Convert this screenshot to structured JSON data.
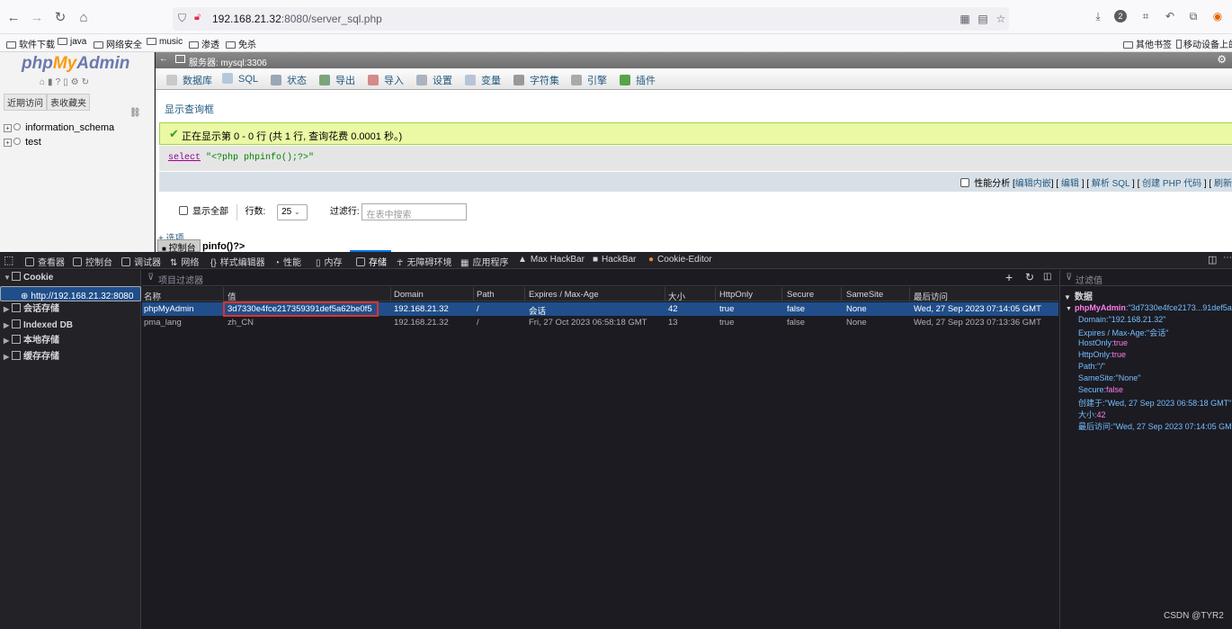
{
  "browser": {
    "url_host": "192.168.21.32",
    "url_rest": ":8080/server_sql.php",
    "bookmarks": [
      "软件下载",
      "java",
      "网络安全",
      "music",
      "渗透",
      "免杀"
    ],
    "bookmarks_right": [
      "其他书签",
      "移动设备上的"
    ]
  },
  "pma": {
    "logo_php": "php",
    "logo_my": "My",
    "logo_admin": "Admin",
    "left_tabs": [
      "近期访问",
      "表收藏夹"
    ],
    "databases": [
      "information_schema",
      "test"
    ],
    "server_label": "服务器: mysql:3306",
    "tabs": [
      "数据库",
      "SQL",
      "状态",
      "导出",
      "导入",
      "设置",
      "变量",
      "字符集",
      "引擎",
      "插件"
    ],
    "show_query_box": "显示查询框",
    "success_msg": "正在显示第 0 - 0 行 (共 1 行, 查询花费 0.0001 秒。)",
    "sql_keyword": "select",
    "sql_string": "\"<?php phpinfo();?>\"",
    "profiling_label": "性能分析",
    "links": [
      "编辑内嵌",
      "编辑",
      "解析 SQL",
      "创建 PHP 代码",
      "刷新"
    ],
    "show_all": "显示全部",
    "rows_label": "行数:",
    "rows_value": "25",
    "filter_label": "过滤行:",
    "filter_placeholder": "在表中搜索",
    "options_link": "+ 选项",
    "console_tab": "控制台",
    "phpinfo_col": "pinfo()?>"
  },
  "devtools": {
    "tabs": [
      "查看器",
      "控制台",
      "调试器",
      "网络",
      "样式编辑器",
      "性能",
      "内存",
      "存储",
      "无障碍环境",
      "应用程序",
      "Max HackBar",
      "HackBar",
      "Cookie-Editor"
    ],
    "active_tab": "存储",
    "tree": {
      "cookie": "Cookie",
      "cookie_host": "http://192.168.21.32:8080",
      "session": "会话存储",
      "indexeddb": "Indexed DB",
      "local": "本地存储",
      "cache": "缓存存储"
    },
    "filter_placeholder": "项目过滤器",
    "columns": [
      "名称",
      "值",
      "Domain",
      "Path",
      "Expires / Max-Age",
      "大小",
      "HttpOnly",
      "Secure",
      "SameSite",
      "最后访问"
    ],
    "rows": [
      [
        "phpMyAdmin",
        "3d7330e4fce217359391def5a62be0f5",
        "192.168.21.32",
        "/",
        "会话",
        "42",
        "true",
        "false",
        "None",
        "Wed, 27 Sep 2023 07:14:05 GMT"
      ],
      [
        "pma_lang",
        "zh_CN",
        "192.168.21.32",
        "/",
        "Fri, 27 Oct 2023 06:58:18 GMT",
        "13",
        "true",
        "false",
        "None",
        "Wed, 27 Sep 2023 07:13:36 GMT"
      ]
    ],
    "sidebar": {
      "filter": "过滤值",
      "data_label": "数据",
      "root_key": "phpMyAdmin",
      "root_val": ":\"3d7330e4fce2173...91def5a62",
      "props": [
        {
          "k": "Domain:",
          "v": "\"192.168.21.32\"",
          "t": "s"
        },
        {
          "k": "Expires / Max-Age:",
          "v": "\"会话\"",
          "t": "s"
        },
        {
          "k": "HostOnly:",
          "v": "true",
          "t": "b"
        },
        {
          "k": "HttpOnly:",
          "v": "true",
          "t": "b"
        },
        {
          "k": "Path:",
          "v": "\"/\"",
          "t": "s"
        },
        {
          "k": "SameSite:",
          "v": "\"None\"",
          "t": "s"
        },
        {
          "k": "Secure:",
          "v": "false",
          "t": "b"
        },
        {
          "k": "创建于:",
          "v": "\"Wed, 27 Sep 2023 06:58:18 GMT\"",
          "t": "s"
        },
        {
          "k": "大小:",
          "v": "42",
          "t": "b"
        },
        {
          "k": "最后访问:",
          "v": "\"Wed, 27 Sep 2023 07:14:05 GMT\"",
          "t": "s"
        }
      ]
    }
  },
  "watermark": "CSDN @TYR2"
}
